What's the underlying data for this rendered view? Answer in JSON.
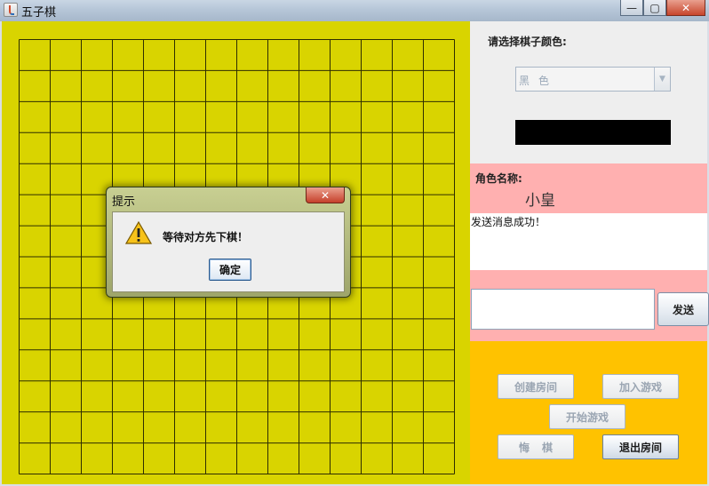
{
  "window": {
    "title": "五子棋",
    "controls": {
      "minimize": "—",
      "maximize": "▢",
      "close": "✕"
    }
  },
  "board": {
    "background": "#d9d400",
    "line_color": "#2e2e00",
    "cols": 14,
    "rows": 14
  },
  "color_panel": {
    "label": "请选择棋子颜色:",
    "selected": "黑色",
    "swatch_color": "#000000"
  },
  "chat": {
    "role_label": "角色名称:",
    "role_name": "小皇",
    "messages": [
      "发送消息成功！"
    ],
    "input_value": "",
    "send_label": "发送"
  },
  "actions": {
    "create_room": "创建房间",
    "join_game": "加入游戏",
    "start_game": "开始游戏",
    "undo": "悔棋",
    "exit_room": "退出房间"
  },
  "dialog": {
    "title": "提示",
    "message": "等待对方先下棋！",
    "ok_label": "确定",
    "close": "✕"
  },
  "icons": {
    "app": "app-icon",
    "warning": "warning-icon",
    "dropdown": "chevron-down-icon"
  }
}
